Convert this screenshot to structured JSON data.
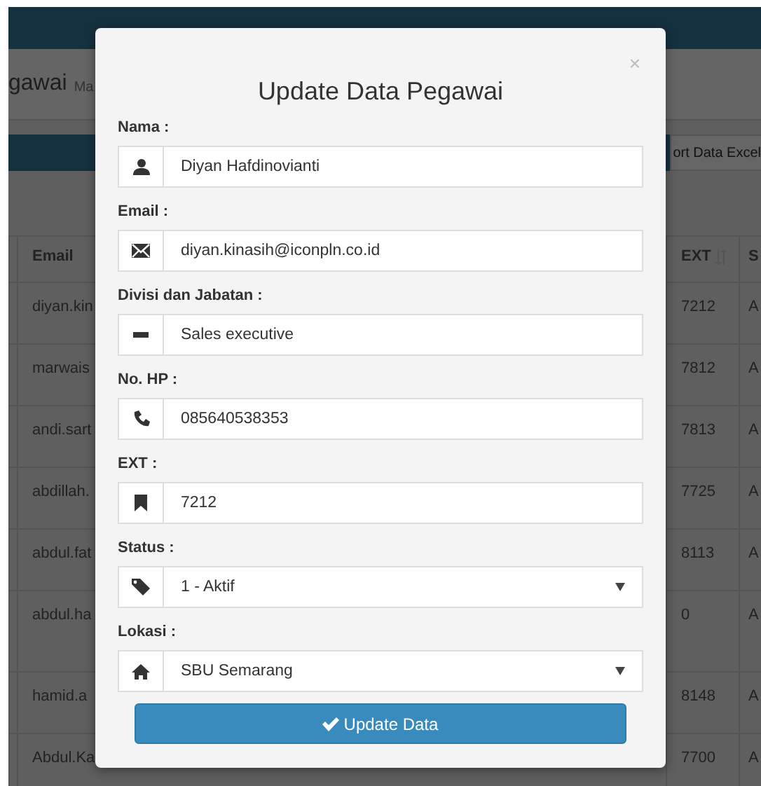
{
  "background": {
    "page_title": "gawai",
    "page_subtitle": "Ma",
    "export_button": "ort Data Excel",
    "table": {
      "columns": [
        "Email",
        "EXT",
        "S"
      ],
      "rows": [
        {
          "cells": [
            "diyan.kin",
            "7212",
            "A"
          ],
          "tall": false
        },
        {
          "cells": [
            "marwais",
            "7812",
            "A"
          ],
          "tall": false
        },
        {
          "cells": [
            "andi.sart",
            "7813",
            "A"
          ],
          "tall": false
        },
        {
          "cells": [
            "abdillah.",
            "7725",
            "A"
          ],
          "tall": false
        },
        {
          "cells": [
            "abdul.fat",
            "8113",
            "A"
          ],
          "tall": false
        },
        {
          "cells": [
            "abdul.ha",
            "0",
            "A"
          ],
          "tall": true
        },
        {
          "cells": [
            "hamid.a",
            "8148",
            "A"
          ],
          "tall": false
        },
        {
          "cells": [
            "Abdul.Ka",
            "7700",
            "A"
          ],
          "tall": false
        }
      ]
    }
  },
  "modal": {
    "title": "Update Data Pegawai",
    "close": "×",
    "fields": [
      {
        "label": "Nama :",
        "kind": "text",
        "value": "Diyan Hafdinovianti"
      },
      {
        "label": "Email :",
        "kind": "text",
        "value": "diyan.kinasih@iconpln.co.id"
      },
      {
        "label": "Divisi dan Jabatan :",
        "kind": "text",
        "value": "Sales executive"
      },
      {
        "label": "No. HP :",
        "kind": "text",
        "value": "085640538353"
      },
      {
        "label": "EXT :",
        "kind": "text",
        "value": "7212"
      },
      {
        "label": "Status :",
        "kind": "select",
        "value": "1 - Aktif"
      },
      {
        "label": "Lokasi :",
        "kind": "select",
        "value": "SBU Semarang"
      }
    ],
    "submit": "Update Data"
  }
}
